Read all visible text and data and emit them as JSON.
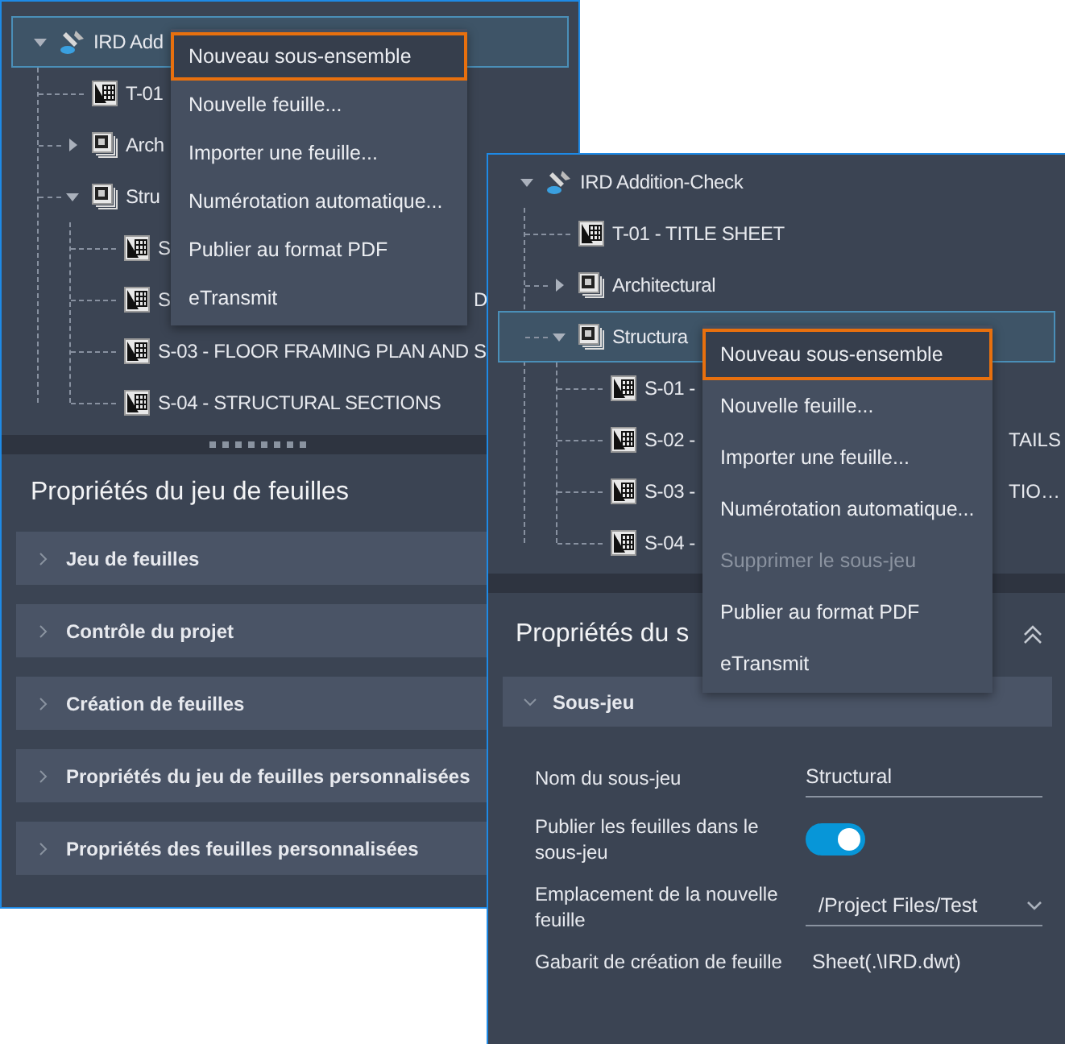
{
  "left_panel": {
    "tree": {
      "label": "IRD Add",
      "kind": "set",
      "expanded": true,
      "selected": true,
      "children": [
        {
          "label": "T-01",
          "kind": "sheet",
          "selected": false
        },
        {
          "label": "Arch",
          "kind": "subset",
          "expanded": false,
          "selected": false
        },
        {
          "label": "Stru",
          "kind": "subset",
          "expanded": true,
          "selected": false,
          "children": [
            {
              "label": "S",
              "kind": "sheet",
              "selected": false
            },
            {
              "label": "S",
              "kind": "sheet",
              "selected": false,
              "trailing": "D"
            },
            {
              "label": "S-03 - FLOOR FRAMING PLAN AND S",
              "kind": "sheet",
              "selected": false
            },
            {
              "label": "S-04 - STRUCTURAL SECTIONS",
              "kind": "sheet",
              "selected": false
            }
          ]
        }
      ]
    },
    "context_menu": [
      {
        "label": "Nouveau sous-ensemble",
        "selected": true,
        "disabled": false
      },
      {
        "label": "Nouvelle feuille...",
        "selected": false,
        "disabled": false
      },
      {
        "label": "Importer une feuille...",
        "selected": false,
        "disabled": false
      },
      {
        "label": "Numérotation automatique...",
        "selected": false,
        "disabled": false
      },
      {
        "label": "Publier au format PDF",
        "selected": false,
        "disabled": false
      },
      {
        "label": "eTransmit",
        "selected": false,
        "disabled": false
      }
    ],
    "properties": {
      "title": "Propriétés du jeu de feuilles",
      "sections": [
        {
          "label": "Jeu de feuilles",
          "expanded": false
        },
        {
          "label": "Contrôle du projet",
          "expanded": false
        },
        {
          "label": "Création de feuilles",
          "expanded": false
        },
        {
          "label": "Propriétés du jeu de feuilles personnalisées",
          "expanded": false
        },
        {
          "label": "Propriétés des feuilles personnalisées",
          "expanded": false
        }
      ]
    }
  },
  "right_panel": {
    "tree": {
      "label": "IRD Addition-Check",
      "kind": "set",
      "expanded": true,
      "selected": false,
      "children": [
        {
          "label": "T-01 - TITLE SHEET",
          "kind": "sheet",
          "selected": false
        },
        {
          "label": "Architectural",
          "kind": "subset",
          "expanded": false,
          "selected": false
        },
        {
          "label": "Structura",
          "kind": "subset",
          "expanded": true,
          "selected": true,
          "children": [
            {
              "label": "S-01 -",
              "kind": "sheet",
              "selected": false
            },
            {
              "label": "S-02 -",
              "kind": "sheet",
              "selected": false,
              "trailing": "TAILS"
            },
            {
              "label": "S-03 -",
              "kind": "sheet",
              "selected": false,
              "trailing": "TIO…"
            },
            {
              "label": "S-04 -",
              "kind": "sheet",
              "selected": false
            }
          ]
        }
      ]
    },
    "context_menu": [
      {
        "label": "Nouveau sous-ensemble",
        "selected": true,
        "disabled": false
      },
      {
        "label": "Nouvelle feuille...",
        "selected": false,
        "disabled": false
      },
      {
        "label": "Importer une feuille...",
        "selected": false,
        "disabled": false
      },
      {
        "label": "Numérotation automatique...",
        "selected": false,
        "disabled": false
      },
      {
        "label": "Supprimer le sous-jeu",
        "selected": false,
        "disabled": true
      },
      {
        "label": "Publier au format PDF",
        "selected": false,
        "disabled": false
      },
      {
        "label": "eTransmit",
        "selected": false,
        "disabled": false
      }
    ],
    "properties": {
      "title": "Propriétés du s",
      "sections": [
        {
          "label": "Sous-jeu",
          "expanded": true,
          "fields": [
            {
              "kind": "text",
              "label": "Nom du sous-jeu",
              "value": "Structural"
            },
            {
              "kind": "toggle",
              "label": "Publier les feuilles dans le sous-jeu",
              "on": true
            },
            {
              "kind": "select",
              "label": "Emplacement de la nouvelle feuille",
              "value": "/Project Files/Test"
            },
            {
              "kind": "plain",
              "label": "Gabarit de création de feuille",
              "value": "Sheet(.\\IRD.dwt)"
            }
          ]
        }
      ]
    }
  }
}
